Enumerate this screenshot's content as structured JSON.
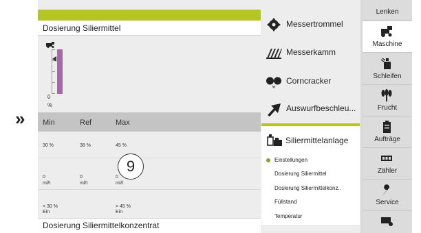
{
  "main": {
    "header_title": "Dosierung Siliermittel",
    "gauge": {
      "value": "0",
      "unit": "%",
      "level": 1.0
    },
    "columns": [
      "Min",
      "Ref",
      "Max"
    ],
    "row1": {
      "min": "30 %",
      "ref": "38 %",
      "max": "45 %"
    },
    "row2": {
      "min": "0",
      "min_unit": "ml/t",
      "ref": "0",
      "ref_unit": "ml/t",
      "max": "0",
      "max_unit": "ml/t"
    },
    "row3": {
      "min": "< 30 %",
      "min_sub": "Ein",
      "max": "> 45 %",
      "max_sub": "Ein"
    },
    "badge": "9",
    "footer_title": "Dosierung Siliermittelkonzentrat"
  },
  "menu": {
    "items": [
      {
        "label": "Messertrommel",
        "icon": "drum-icon"
      },
      {
        "label": "Messerkamm",
        "icon": "knife-comb-icon"
      },
      {
        "label": "Corncracker",
        "icon": "corncracker-icon"
      },
      {
        "label": "Auswurfbeschleu...",
        "icon": "accelerator-icon"
      }
    ],
    "active": {
      "label": "Siliermittelanlage",
      "icon": "silage-agent-icon"
    },
    "subitems": [
      "Einstellungen",
      "Dosierung Siliermittel",
      "Dosierung Siliermittelkonz..",
      "Füllstand",
      "Temperatur"
    ]
  },
  "nav": {
    "items": [
      {
        "label": "Lenken",
        "icon": "steering-icon"
      },
      {
        "label": "Maschine",
        "icon": "harvester-icon"
      },
      {
        "label": "Schleifen",
        "icon": "grinding-icon"
      },
      {
        "label": "Frucht",
        "icon": "crop-icon"
      },
      {
        "label": "Aufträge",
        "icon": "clipboard-icon"
      },
      {
        "label": "Zähler",
        "icon": "counter-icon"
      },
      {
        "label": "Service",
        "icon": "wrench-icon"
      }
    ]
  },
  "colors": {
    "accent": "#b5c522",
    "gauge_fill": "#a36aa6",
    "header_bar": "#c4c4c4"
  }
}
